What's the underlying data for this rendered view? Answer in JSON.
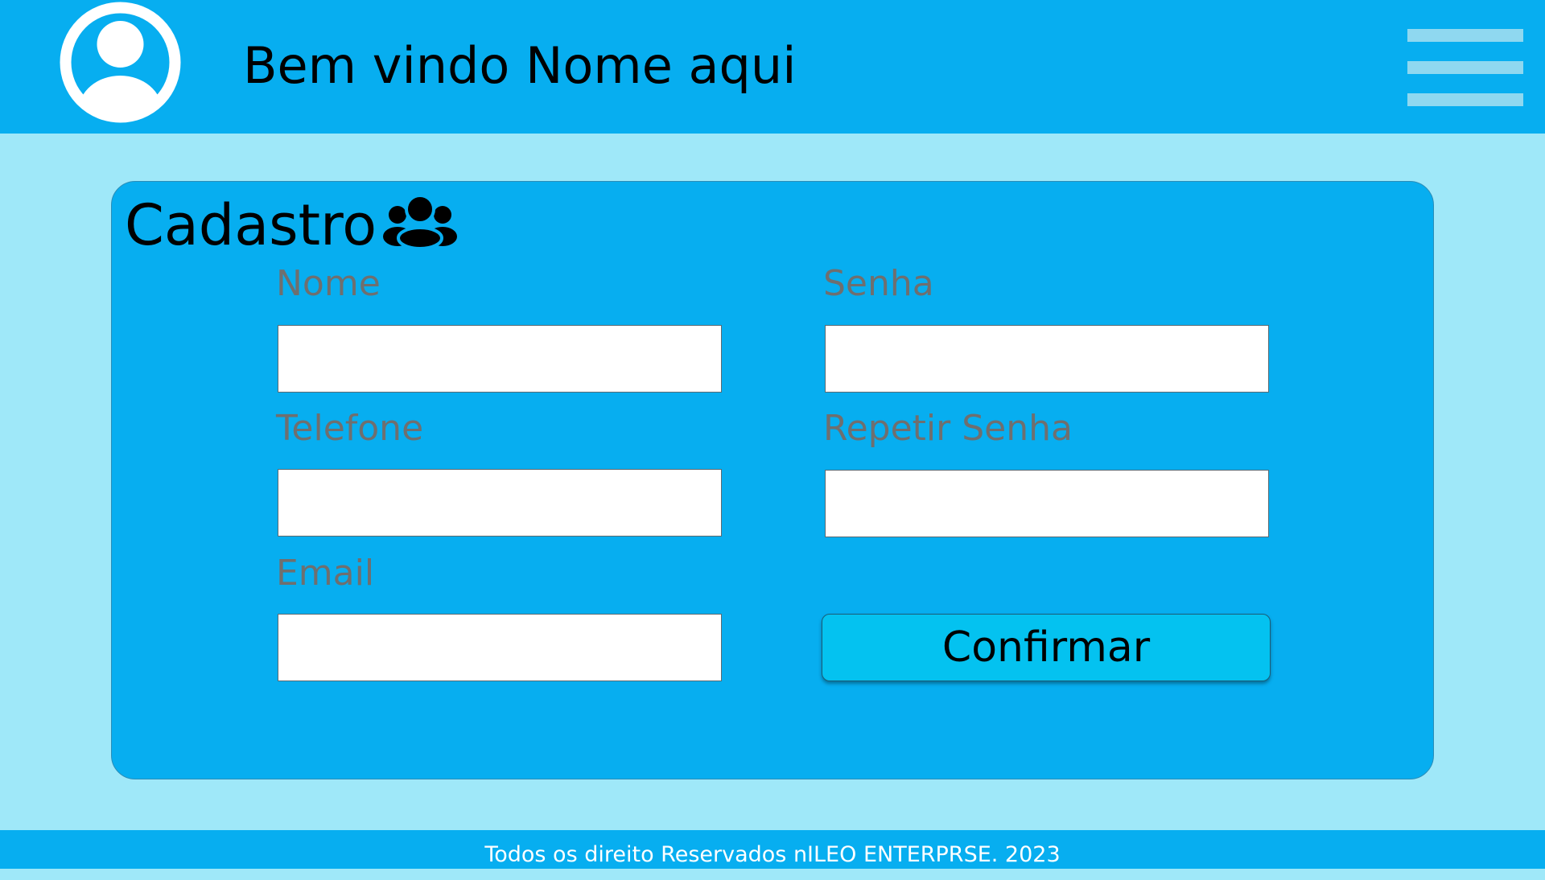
{
  "header": {
    "welcome_text": "Bem vindo Nome aqui",
    "avatar_icon": "user-circle-icon",
    "menu_icon": "hamburger-menu-icon"
  },
  "form": {
    "title": "Cadastro",
    "title_icon": "users-group-icon",
    "fields": [
      {
        "label": "Nome",
        "value": "",
        "placeholder": ""
      },
      {
        "label": "Senha",
        "value": "",
        "placeholder": ""
      },
      {
        "label": "Telefone",
        "value": "",
        "placeholder": ""
      },
      {
        "label": "Repetir Senha",
        "value": "",
        "placeholder": ""
      },
      {
        "label": "Email",
        "value": "",
        "placeholder": ""
      }
    ],
    "confirm_label": "Confirmar"
  },
  "footer": {
    "text": "Todos os direito Reservados nILEO ENTERPRSE. 2023"
  },
  "colors": {
    "page_background": "#9fe8f9",
    "header_background": "#07aef0",
    "card_background": "#07aef0",
    "button_background": "#04c2f0",
    "label_text": "#6f6f6f",
    "footer_text": "#ffffff"
  }
}
